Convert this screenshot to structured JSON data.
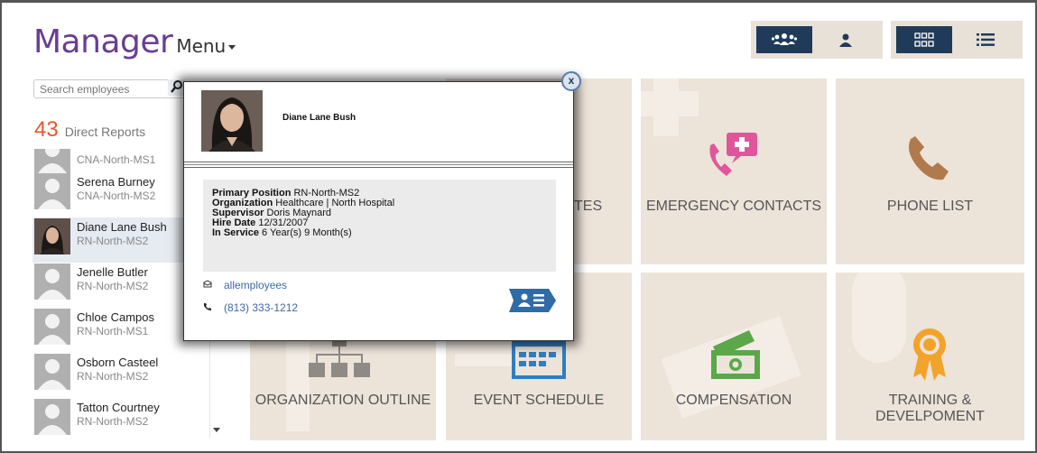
{
  "header": {
    "title": "Manager",
    "menu_label": "Menu"
  },
  "search": {
    "placeholder": "Search employees"
  },
  "direct_reports": {
    "count": "43",
    "label": "Direct Reports"
  },
  "employees": [
    {
      "name": "",
      "position": "CNA-North-MS1",
      "photo": false
    },
    {
      "name": "Serena Burney",
      "position": "CNA-North-MS2",
      "photo": false
    },
    {
      "name": "Diane Lane Bush",
      "position": "RN-North-MS2",
      "photo": true,
      "selected": true
    },
    {
      "name": "Jenelle Butler",
      "position": "RN-North-MS2",
      "photo": false
    },
    {
      "name": "Chloe Campos",
      "position": "RN-North-MS1",
      "photo": false
    },
    {
      "name": "Osborn Casteel",
      "position": "RN-North-MS2",
      "photo": false
    },
    {
      "name": "Tatton Courtney",
      "position": "RN-North-MS2",
      "photo": false
    }
  ],
  "tiles": {
    "notes_partial": "TES",
    "emergency_contacts": "EMERGENCY CONTACTS",
    "phone_list": "PHONE LIST",
    "organization_outline": "ORGANIZATION OUTLINE",
    "event_schedule": "EVENT SCHEDULE",
    "compensation": "COMPENSATION",
    "training": "TRAINING & DEVELPOMENT"
  },
  "popup": {
    "close_label": "x",
    "name": "Diane Lane Bush",
    "primary_position_label": "Primary Position",
    "primary_position": "RN-North-MS2",
    "organization_label": "Organization",
    "organization": "Healthcare | North Hospital",
    "supervisor_label": "Supervisor",
    "supervisor": "Doris Maynard",
    "hire_date_label": "Hire Date",
    "hire_date": "12/31/2007",
    "in_service_label": "In Service",
    "in_service": "6 Year(s) 9 Month(s)",
    "email": "allemployees",
    "phone": "(813) 333-1212"
  },
  "icons": {
    "team_view": "group-icon",
    "single_view": "person-icon",
    "grid_view": "grid-icon",
    "list_view": "list-icon",
    "search": "search-icon",
    "email": "envelope-icon",
    "phone": "phone-icon",
    "card": "contact-card-icon",
    "organization": "org-chart-icon",
    "event": "calendar-icon",
    "compensation": "money-icon",
    "training": "award-ribbon-icon",
    "emergency": "medical-phone-icon",
    "phone_list": "handset-icon"
  },
  "colors": {
    "brand": "#6a3d91",
    "count": "#e8562a",
    "active_toggle": "#1f3b59",
    "tile_bg": "#ece3d9",
    "emergency_icon": "#e0569b",
    "phone_icon": "#b07a4c",
    "accent_blue": "#2f7ec2",
    "compensation_icon": "#5aa84a",
    "training_icon": "#f2a32c",
    "link": "#3c69a8"
  }
}
